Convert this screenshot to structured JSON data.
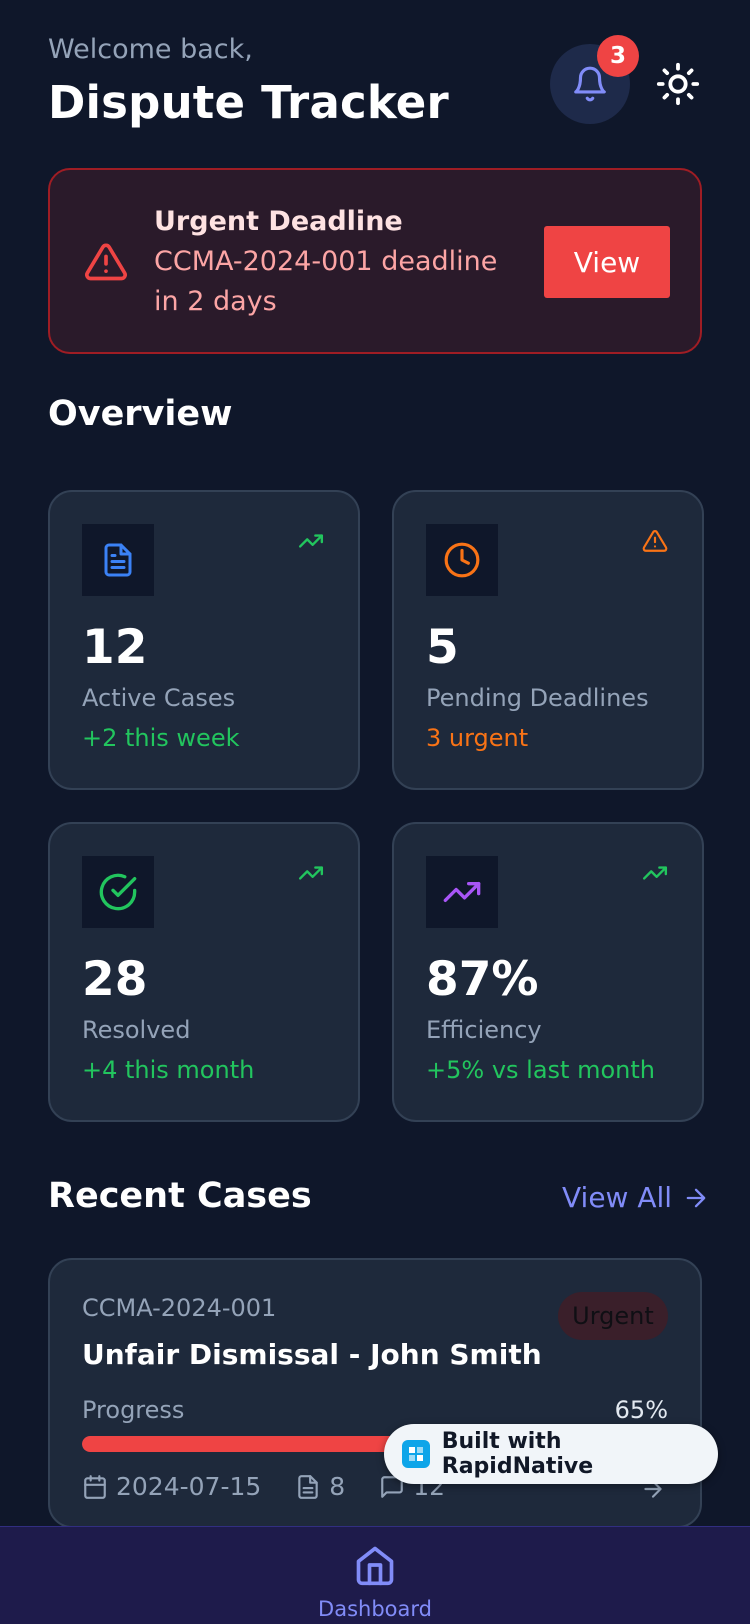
{
  "header": {
    "welcome": "Welcome back,",
    "title": "Dispute Tracker",
    "notification_count": "3",
    "bell_icon": "bell-icon",
    "theme_icon": "sun-icon"
  },
  "alert": {
    "title": "Urgent Deadline",
    "message": "CCMA-2024-001 deadline in 2 days",
    "button_label": "View",
    "icon": "warning-triangle-icon"
  },
  "overview": {
    "title": "Overview",
    "stats": [
      {
        "value": "12",
        "label": "Active Cases",
        "sub": "+2 this week",
        "icon": "document-icon",
        "trend_icon": "trending-up-icon",
        "accent": "#3b82f6",
        "sub_color": "#22c55e"
      },
      {
        "value": "5",
        "label": "Pending Deadlines",
        "sub": "3 urgent",
        "icon": "clock-icon",
        "trend_icon": "warning-triangle-icon",
        "accent": "#f97316",
        "sub_color": "#f97316"
      },
      {
        "value": "28",
        "label": "Resolved",
        "sub": "+4 this month",
        "icon": "check-circle-icon",
        "trend_icon": "trending-up-icon",
        "accent": "#22c55e",
        "sub_color": "#22c55e"
      },
      {
        "value": "87%",
        "label": "Efficiency",
        "sub": "+5% vs last month",
        "icon": "trending-up-icon",
        "trend_icon": "trending-up-icon",
        "accent": "#a855f7",
        "sub_color": "#22c55e"
      }
    ]
  },
  "recent": {
    "title": "Recent Cases",
    "view_all": "View All",
    "cases": [
      {
        "id": "CCMA-2024-001",
        "status": "Urgent",
        "title": "Unfair Dismissal - John Smith",
        "progress_label": "Progress",
        "progress_text": "65%",
        "progress": 0.65,
        "date": "2024-07-15",
        "documents": "8",
        "comments": "12"
      }
    ]
  },
  "badge": {
    "text": "Built with RapidNative"
  },
  "nav": {
    "items": [
      {
        "label": "Dashboard",
        "icon": "home-icon"
      }
    ]
  },
  "colors": {
    "background": "#0f172a",
    "card": "#1e293b",
    "accent": "#818cf8",
    "danger": "#ef4444"
  }
}
